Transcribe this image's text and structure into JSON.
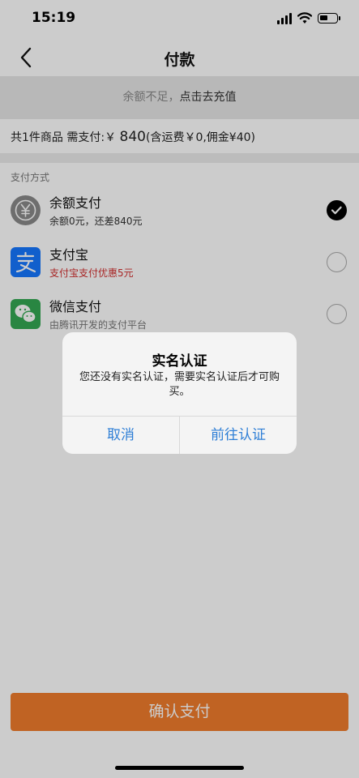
{
  "status_bar": {
    "time": "15:19"
  },
  "nav": {
    "title": "付款"
  },
  "notice": {
    "text": "余额不足，",
    "link": "点击去充值"
  },
  "summary": {
    "prefix": "共1件商品 需支付:￥",
    "amount": "840",
    "suffix": "(含运费￥0,佣金¥40)"
  },
  "payment": {
    "section_label": "支付方式",
    "methods": [
      {
        "name": "余额支付",
        "sub": "余额0元，还差840元",
        "selected": true,
        "icon": "balance-yuan-icon"
      },
      {
        "name": "支付宝",
        "sub": "支付宝支付优惠5元",
        "selected": false,
        "icon": "alipay-icon"
      },
      {
        "name": "微信支付",
        "sub": "由腾讯开发的支付平台",
        "selected": false,
        "icon": "wechat-icon"
      }
    ]
  },
  "confirm": {
    "label": "确认支付"
  },
  "alert": {
    "title": "实名认证",
    "message": "您还没有实名认证，需要实名认证后才可购买。",
    "cancel": "取消",
    "confirm": "前往认证"
  },
  "colors": {
    "accent": "#f07c2c",
    "alert_button": "#2f7fd6",
    "promo_red": "#d32f2f"
  }
}
